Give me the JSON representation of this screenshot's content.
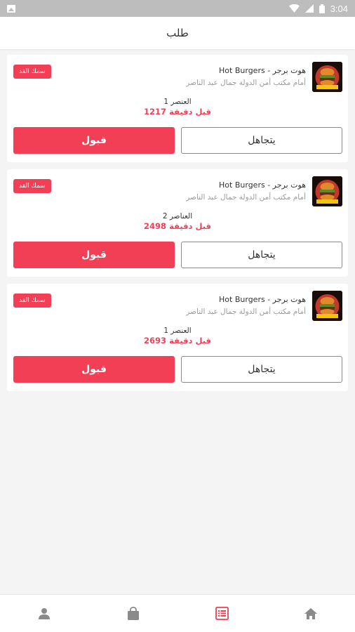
{
  "status_bar": {
    "time": "3:04"
  },
  "header": {
    "title": "طلب"
  },
  "orders": [
    {
      "restaurant": "Hot Burgers - هوت برجر",
      "address": "أمام مكتب أمن الدولة جمال عبد الناصر",
      "badge": "سمك القد",
      "items": "1 العنصر",
      "time_ago": "1217 قبل دقيقة",
      "ignore_label": "يتجاهل",
      "accept_label": "قبول"
    },
    {
      "restaurant": "Hot Burgers - هوت برجر",
      "address": "أمام مكتب أمن الدولة جمال عبد الناصر",
      "badge": "سمك القد",
      "items": "2 العناصر",
      "time_ago": "2498 قبل دقيقة",
      "ignore_label": "يتجاهل",
      "accept_label": "قبول"
    },
    {
      "restaurant": "Hot Burgers - هوت برجر",
      "address": "أمام مكتب أمن الدولة جمال عبد الناصر",
      "badge": "سمك القد",
      "items": "1 العنصر",
      "time_ago": "2693 قبل دقيقة",
      "ignore_label": "يتجاهل",
      "accept_label": "قبول"
    }
  ],
  "bottom_nav": [
    {
      "icon": "person-icon",
      "active": false
    },
    {
      "icon": "shopping-bag-icon",
      "active": false
    },
    {
      "icon": "orders-list-icon",
      "active": true
    },
    {
      "icon": "home-icon",
      "active": false
    }
  ],
  "colors": {
    "accent": "#f23f56",
    "inactive_icon": "#8a8a8a"
  }
}
